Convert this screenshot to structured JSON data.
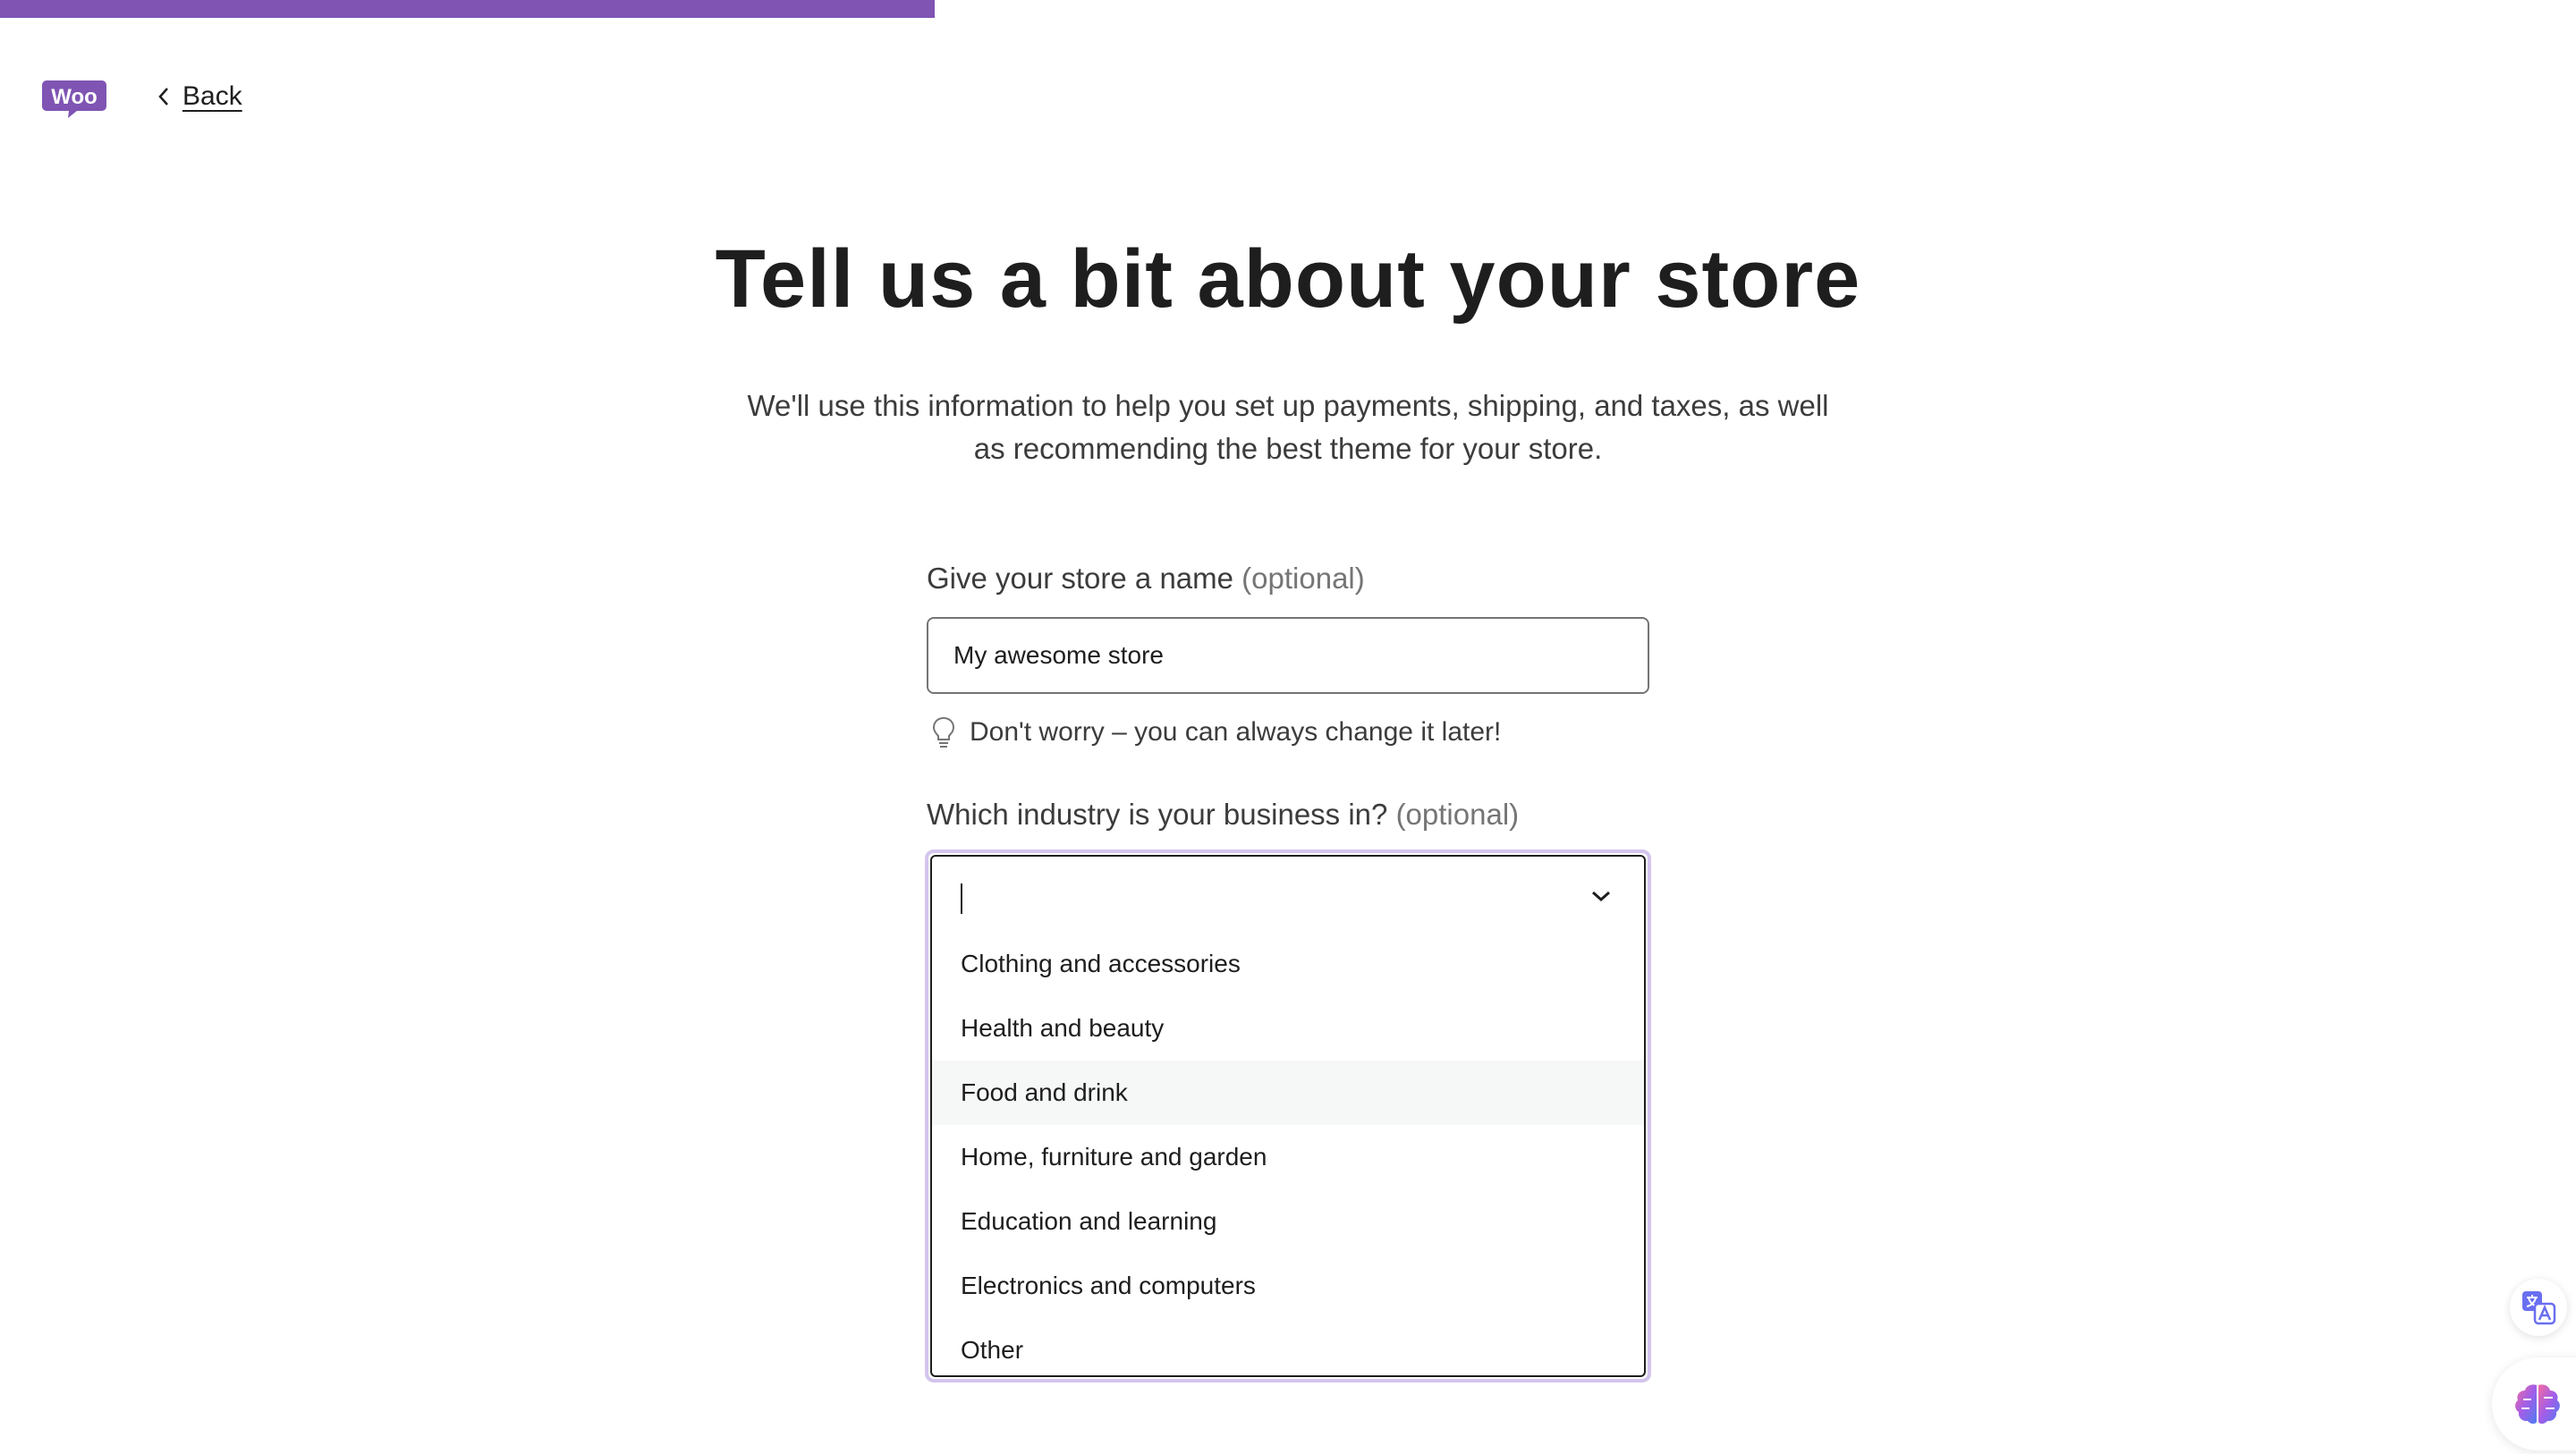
{
  "progress": {
    "fraction": 0.363,
    "color": "#7f54b3"
  },
  "header": {
    "logo_text": "Woo",
    "back_label": "Back"
  },
  "page": {
    "title": "Tell us a bit about your store",
    "subtitle": "We'll use this information to help you set up payments, shipping, and taxes, as well as recommending the best theme for your store."
  },
  "store_name": {
    "label": "Give your store a name",
    "optional": "(optional)",
    "value": "My awesome store",
    "hint": "Don't worry – you can always change it later!"
  },
  "industry": {
    "label": "Which industry is your business in?",
    "optional": "(optional)",
    "value": "",
    "options": [
      {
        "label": "Clothing and accessories",
        "highlighted": false
      },
      {
        "label": "Health and beauty",
        "highlighted": false
      },
      {
        "label": "Food and drink",
        "highlighted": true
      },
      {
        "label": "Home, furniture and garden",
        "highlighted": false
      },
      {
        "label": "Education and learning",
        "highlighted": false
      },
      {
        "label": "Electronics and computers",
        "highlighted": false
      },
      {
        "label": "Other",
        "highlighted": false
      }
    ]
  },
  "floating": {
    "translate_icon": "translate-icon",
    "brain_icon": "brain-icon"
  }
}
